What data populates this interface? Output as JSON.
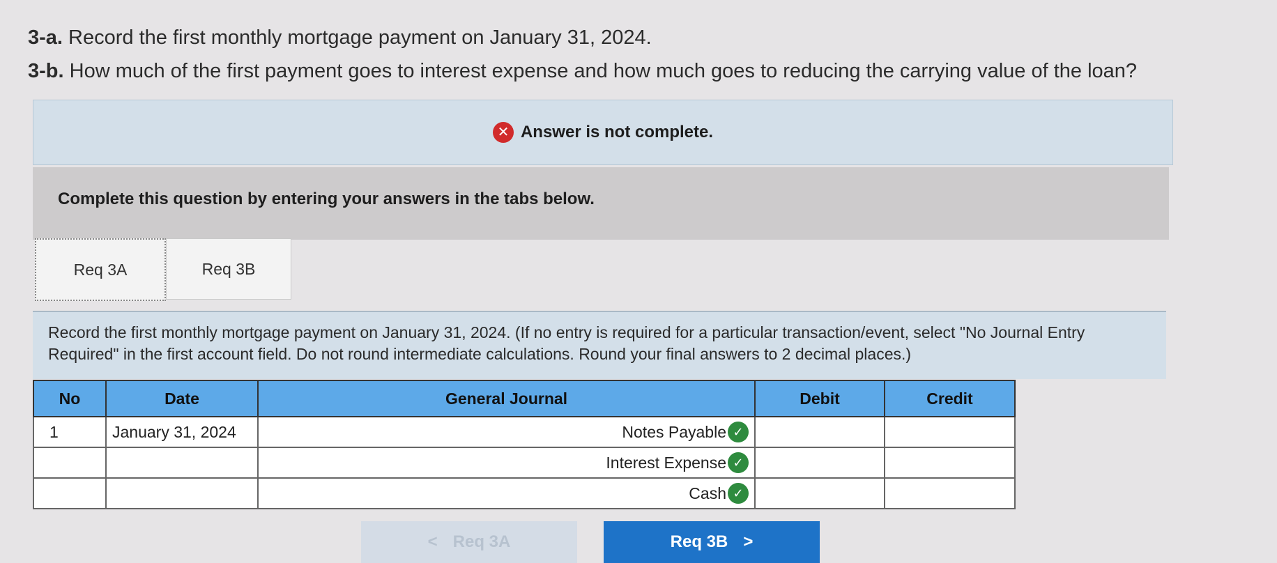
{
  "question": {
    "part_a_label": "3-a.",
    "part_a_text": "Record the first monthly mortgage payment on January 31, 2024.",
    "part_b_label": "3-b.",
    "part_b_text": "How much of the first payment goes to interest expense and how much goes to reducing the carrying value of the loan?"
  },
  "status": {
    "message": "Answer is not complete.",
    "icon": "x-circle-icon",
    "color": "#d12b2b"
  },
  "instructions": "Complete this question by entering your answers in the tabs below.",
  "tabs": [
    {
      "label": "Req 3A",
      "active": true
    },
    {
      "label": "Req 3B",
      "active": false
    }
  ],
  "record_instructions": "Record the first monthly mortgage payment on January 31, 2024. (If no entry is required for a particular transaction/event, select \"No Journal Entry Required\" in the first account field. Do not round intermediate calculations. Round your final answers to 2 decimal places.)",
  "journal": {
    "headers": {
      "no": "No",
      "date": "Date",
      "general_journal": "General Journal",
      "debit": "Debit",
      "credit": "Credit"
    },
    "rows": [
      {
        "no": "1",
        "date": "January 31, 2024",
        "account": "Notes Payable",
        "debit": "",
        "credit": "",
        "correct": true
      },
      {
        "no": "",
        "date": "",
        "account": "Interest Expense",
        "debit": "",
        "credit": "",
        "correct": true
      },
      {
        "no": "",
        "date": "",
        "account": "Cash",
        "debit": "",
        "credit": "",
        "correct": true
      }
    ],
    "header_color": "#5da9e8"
  },
  "nav": {
    "prev_label": "Req 3A",
    "next_label": "Req 3B",
    "prev_arrow": "<",
    "next_arrow": ">"
  }
}
